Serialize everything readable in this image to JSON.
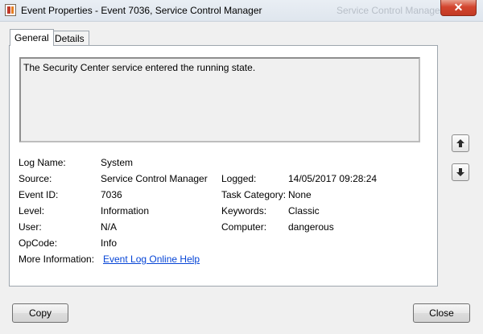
{
  "window": {
    "title": "Event Properties - Event 7036, Service Control Manager",
    "background_title": "Service Control Manager",
    "close_glyph": "✕"
  },
  "tabs": [
    {
      "label": "General",
      "active": true
    },
    {
      "label": "Details",
      "active": false
    }
  ],
  "event": {
    "description": "The Security Center service entered the running state.",
    "fields_left": [
      {
        "label": "Log Name:",
        "value": "System"
      },
      {
        "label": "Source:",
        "value": "Service Control Manager"
      },
      {
        "label": "Event ID:",
        "value": "7036"
      },
      {
        "label": "Level:",
        "value": "Information"
      },
      {
        "label": "User:",
        "value": "N/A"
      },
      {
        "label": "OpCode:",
        "value": "Info"
      }
    ],
    "fields_right": [
      {
        "label": "Logged:",
        "value": "14/05/2017 09:28:24"
      },
      {
        "label": "Task Category:",
        "value": "None"
      },
      {
        "label": "Keywords:",
        "value": "Classic"
      },
      {
        "label": "Computer:",
        "value": "dangerous"
      }
    ],
    "more_info_label": "More Information:",
    "more_info_link": "Event Log Online Help"
  },
  "buttons": {
    "copy": "Copy",
    "close": "Close"
  },
  "icons": {
    "app": "event-viewer-icon",
    "up": "arrow-up-icon",
    "down": "arrow-down-icon"
  }
}
